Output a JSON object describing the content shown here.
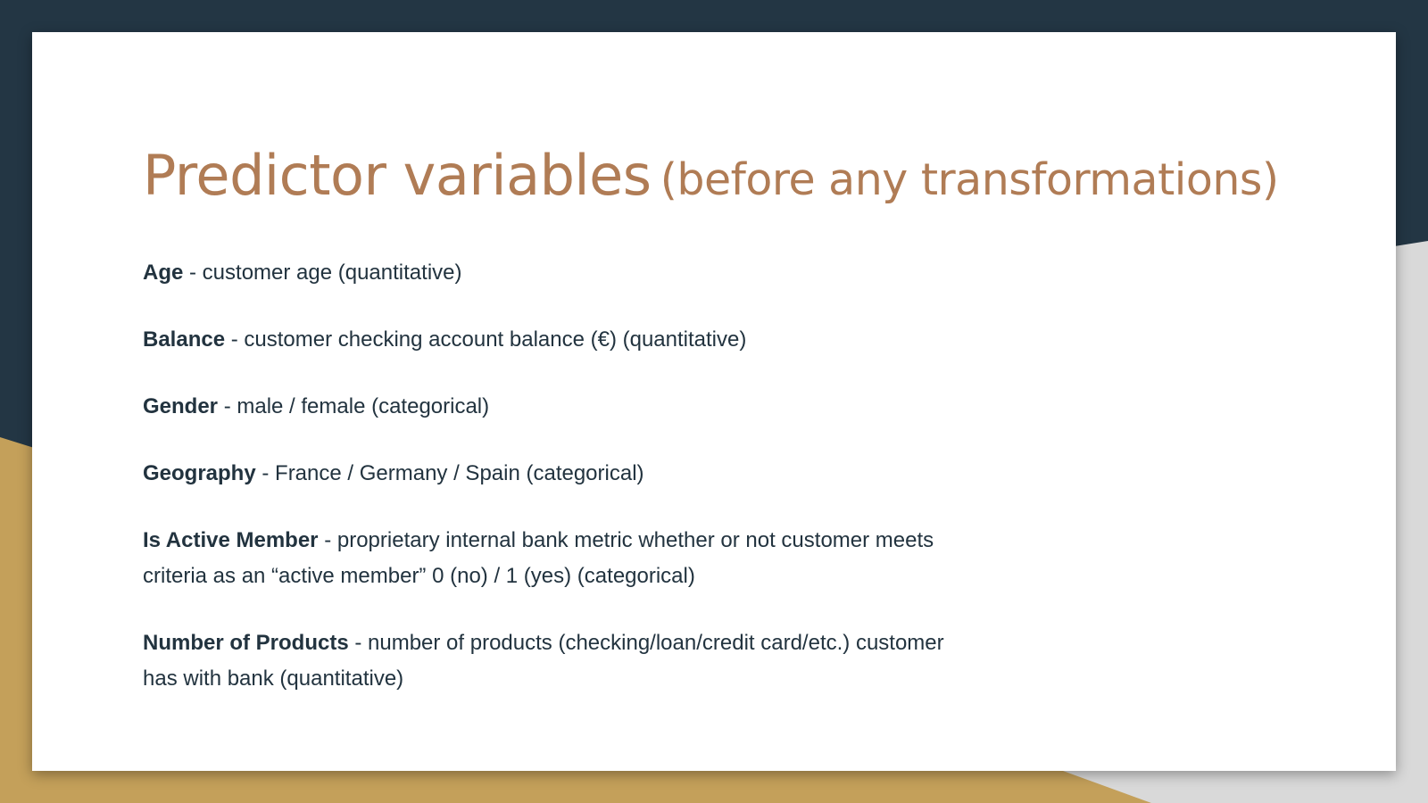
{
  "colors": {
    "navy": "#233644",
    "gold": "#c4a05a",
    "grey": "#d9d9d9",
    "title": "#b07c55",
    "text": "#22333f"
  },
  "title": {
    "main": "Predictor variables",
    "sub": "(before any transformations)"
  },
  "variables": [
    {
      "name": "Age",
      "separator": " - ",
      "description": "customer age (quantitative)"
    },
    {
      "name": "Balance",
      "separator": " - ",
      "description": "customer checking account balance (€) (quantitative)"
    },
    {
      "name": "Gender",
      "separator": " - ",
      "description": "male / female (categorical)"
    },
    {
      "name": "Geography",
      "separator": " - ",
      "description": "France / Germany / Spain (categorical)"
    },
    {
      "name": "Is Active Member",
      "separator": " - ",
      "description": "proprietary internal bank metric whether or not customer meets criteria as an “active member” 0 (no) / 1 (yes) (categorical)"
    },
    {
      "name": "Number of Products",
      "separator": " - ",
      "description": "number of products (checking/loan/credit card/etc.) customer has with bank (quantitative)"
    }
  ]
}
